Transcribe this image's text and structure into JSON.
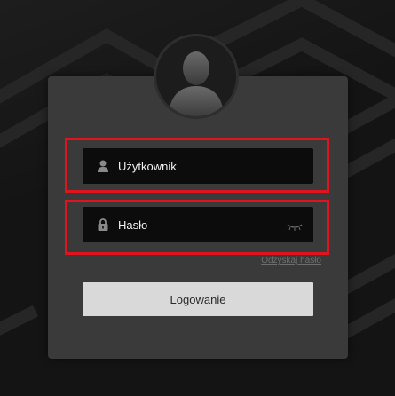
{
  "login": {
    "username_placeholder": "Użytkownik",
    "password_placeholder": "Hasło",
    "recover_link": "Odzyskaj hasło",
    "login_button": "Logowanie"
  },
  "icons": {
    "avatar": "user-silhouette-icon",
    "username": "user-icon",
    "password": "lock-icon",
    "toggle_visibility": "eye-closed-icon"
  },
  "colors": {
    "highlight": "#e0141e",
    "card": "#3a3a3a",
    "field": "#0c0c0c",
    "button": "#d9d9d9"
  }
}
